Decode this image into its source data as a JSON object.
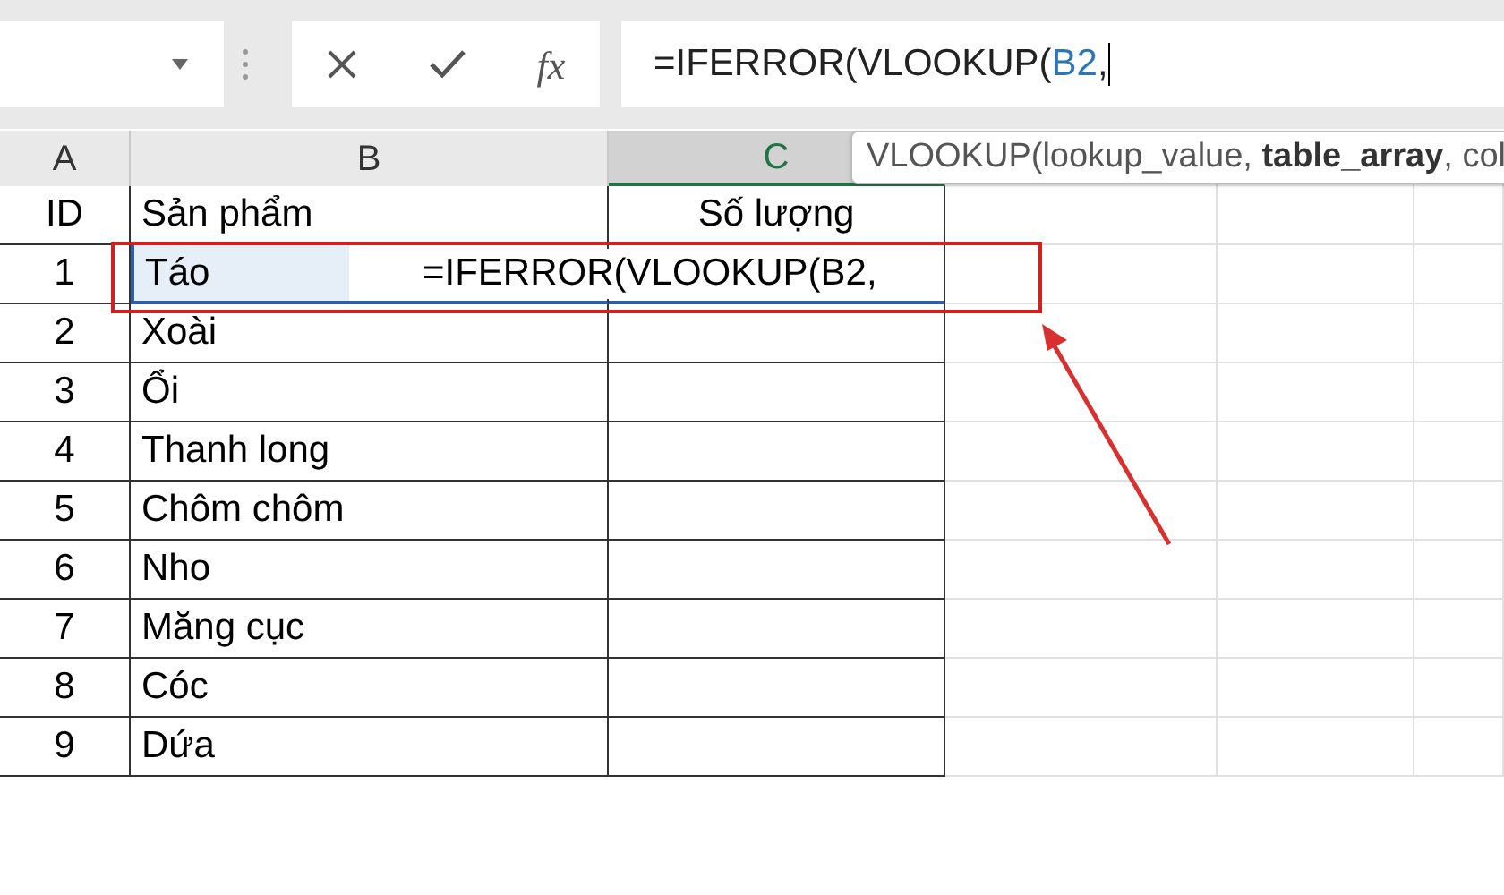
{
  "formula_bar": {
    "formula_parts": [
      {
        "text": "=IFERROR(VLOOKUP(",
        "kind": "plain"
      },
      {
        "text": "B2",
        "kind": "ref"
      },
      {
        "text": ",",
        "kind": "plain"
      }
    ]
  },
  "columns": [
    {
      "label": "A",
      "selected": false
    },
    {
      "label": "B",
      "selected": false
    },
    {
      "label": "C",
      "selected": true
    }
  ],
  "function_button": "fx",
  "tooltip_parts": [
    {
      "text": "VLOOKUP(lookup_value, ",
      "bold": false
    },
    {
      "text": "table_array",
      "bold": true
    },
    {
      "text": ", col",
      "bold": false
    }
  ],
  "rows": [
    {
      "cells": [
        "ID",
        "Sản phẩm",
        "Số lượng"
      ]
    },
    {
      "cells": [
        "1",
        "Táo",
        "=IFERROR(VLOOKUP(B2,"
      ],
      "editing": true
    },
    {
      "cells": [
        "2",
        "Xoài",
        ""
      ]
    },
    {
      "cells": [
        "3",
        "Ổi",
        ""
      ]
    },
    {
      "cells": [
        "4",
        "Thanh long",
        ""
      ]
    },
    {
      "cells": [
        "5",
        "Chôm chôm",
        ""
      ]
    },
    {
      "cells": [
        "6",
        "Nho",
        ""
      ]
    },
    {
      "cells": [
        "7",
        "Măng cục",
        ""
      ]
    },
    {
      "cells": [
        "8",
        "Cóc",
        ""
      ]
    },
    {
      "cells": [
        "9",
        "Dứa",
        ""
      ]
    }
  ]
}
